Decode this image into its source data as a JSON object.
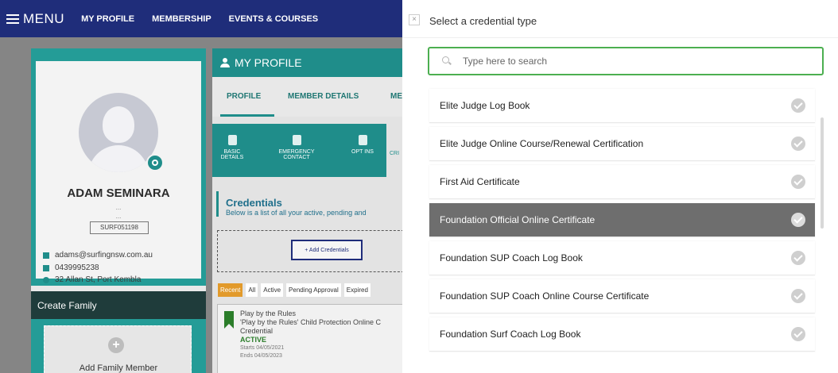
{
  "nav": {
    "menu_label": "MENU",
    "links": [
      "MY PROFILE",
      "MEMBERSHIP",
      "EVENTS & COURSES"
    ]
  },
  "profile_card": {
    "name": "ADAM SEMINARA",
    "dots1": "...",
    "dots2": "...",
    "member_id": "SURF051198",
    "email": "adams@surfingnsw.com.au",
    "phone": "0439995238",
    "address": "32 Allan St, Port Kembla",
    "family_header": "Create Family",
    "add_family": "Add Family Member"
  },
  "profile_panel": {
    "title": "MY PROFILE",
    "tabs": [
      "PROFILE",
      "MEMBER DETAILS",
      "ME"
    ],
    "subtabs": [
      "BASIC DETAILS",
      "EMERGENCY CONTACT",
      "OPT INS",
      "CRI"
    ],
    "credentials_title": "Credentials",
    "credentials_sub": "Below is a list of all your active, pending and",
    "add_credentials": "+ Add Credentials",
    "filters": [
      "Recent",
      "All",
      "Active",
      "Pending Approval",
      "Expired"
    ],
    "credential": {
      "name": "Play by the Rules",
      "desc1": "'Play by the Rules' Child Protection Online C",
      "desc2": "Credential",
      "status": "ACTIVE",
      "starts": "Starts  04/05/2021",
      "ends": "Ends   04/05/2023"
    }
  },
  "dialog": {
    "close_glyph": "×",
    "title": "Select a credential type",
    "search_placeholder": "Type here to search",
    "items": [
      "Elite Judge Log Book",
      "Elite Judge Online Course/Renewal Certification",
      "First Aid Certificate",
      "Foundation Official Online Certificate",
      "Foundation SUP Coach Log Book",
      "Foundation SUP Coach Online Course Certificate",
      "Foundation Surf Coach Log Book"
    ],
    "selected_index": 3
  },
  "colors": {
    "nav": "#1f2d7a",
    "teal": "#249c97",
    "selected": "#6e6e6e",
    "search_border": "#4caf50"
  }
}
